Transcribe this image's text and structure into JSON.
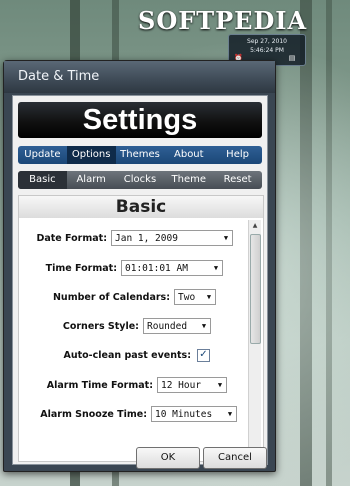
{
  "watermark": "SOFTPEDIA",
  "clock": {
    "date": "Sep 27, 2010",
    "time": "5:46:24 PM"
  },
  "window": {
    "title": "Date & Time"
  },
  "banner": "Settings",
  "main_tabs": [
    {
      "label": "Update"
    },
    {
      "label": "Options"
    },
    {
      "label": "Themes"
    },
    {
      "label": "About"
    },
    {
      "label": "Help"
    }
  ],
  "active_main_tab": "Options",
  "sub_tabs": [
    {
      "label": "Basic"
    },
    {
      "label": "Alarm"
    },
    {
      "label": "Clocks"
    },
    {
      "label": "Theme"
    },
    {
      "label": "Reset"
    }
  ],
  "active_sub_tab": "Basic",
  "panel": {
    "title": "Basic"
  },
  "settings": {
    "date_format": {
      "label": "Date Format:",
      "value": "Jan 1, 2009"
    },
    "time_format": {
      "label": "Time Format:",
      "value": "01:01:01 AM"
    },
    "num_calendars": {
      "label": "Number of Calendars:",
      "value": "Two"
    },
    "corners_style": {
      "label": "Corners Style:",
      "value": "Rounded"
    },
    "auto_clean": {
      "label": "Auto-clean past events:",
      "checked": true
    },
    "alarm_time_format": {
      "label": "Alarm Time Format:",
      "value": "12 Hour"
    },
    "alarm_snooze": {
      "label": "Alarm Snooze Time:",
      "value": "10 Minutes"
    }
  },
  "buttons": {
    "ok": "OK",
    "cancel": "Cancel"
  },
  "icons": {
    "caret": "chevron-down-icon",
    "check": "checkmark-icon"
  }
}
